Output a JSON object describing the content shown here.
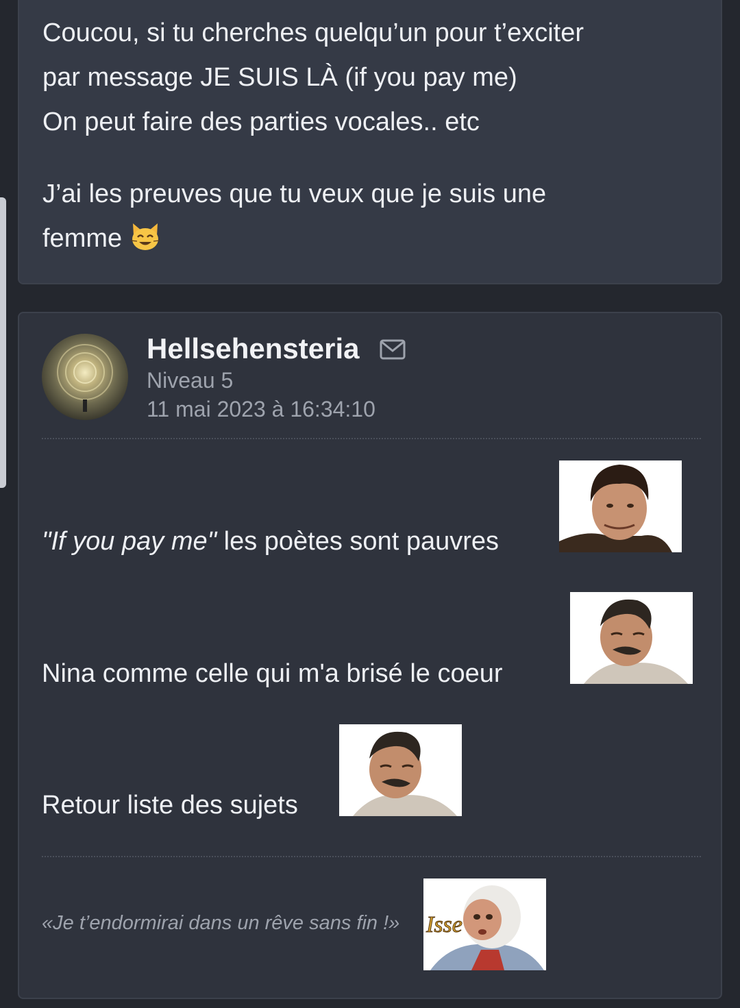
{
  "previous_post": {
    "lines": [
      "Coucou, si tu cherches quelqu’un pour t’exciter",
      "par message JE SUIS LÀ (if you pay me)",
      "On peut faire des parties vocales.. etc"
    ],
    "line2a": "J’ai les preuves que tu veux que je suis une",
    "line2b": "femme",
    "emoji": "smiling-cat-emoji"
  },
  "post": {
    "author": "Hellsehensteria",
    "level": "Niveau 5",
    "date": "11 mai 2023 à 16:34:10",
    "message": {
      "quote": "\"If you pay me\"",
      "line1_rest": " les poètes sont pauvres",
      "line2": "Nina comme celle qui m'a brisé le coeur",
      "line3": "Retour liste des sujets"
    },
    "signature": "«Je t’endormirai dans un rêve sans fin !»",
    "signature_sticker_text": "Isse"
  },
  "colors": {
    "background": "#24272e",
    "card": "#2f333d",
    "card_top": "#353a46",
    "text": "#eef0f4",
    "muted": "#9ea3ad"
  }
}
